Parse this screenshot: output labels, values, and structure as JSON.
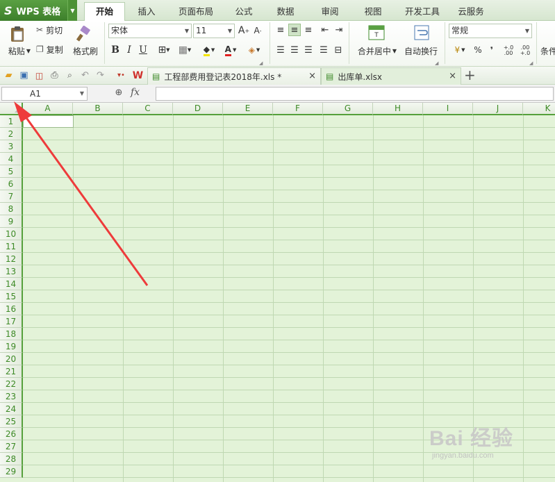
{
  "app": {
    "name": "WPS 表格",
    "logo_letter": "S"
  },
  "menu_tabs": [
    {
      "label": "开始",
      "active": true
    },
    {
      "label": "插入",
      "active": false
    },
    {
      "label": "页面布局",
      "active": false
    },
    {
      "label": "公式",
      "active": false
    },
    {
      "label": "数据",
      "active": false
    },
    {
      "label": "审阅",
      "active": false
    },
    {
      "label": "视图",
      "active": false
    },
    {
      "label": "开发工具",
      "active": false
    },
    {
      "label": "云服务",
      "active": false
    }
  ],
  "ribbon": {
    "paste": "粘贴",
    "cut": "剪切",
    "copy": "复制",
    "format_painter": "格式刷",
    "font_name": "宋体",
    "font_size": "11",
    "bold": "B",
    "italic": "I",
    "underline": "U",
    "merge_center": "合并居中",
    "wrap_text": "自动换行",
    "number_format": "常规",
    "percent": "%",
    "comma": "❜",
    "conditional": "条件"
  },
  "documents": [
    {
      "title": "工程部费用登记表2018年.xls *",
      "active": false
    },
    {
      "title": "出库单.xlsx",
      "active": true
    }
  ],
  "formula_bar": {
    "name_box": "A1",
    "fx_label": "fx",
    "formula": ""
  },
  "sheet": {
    "columns": [
      "A",
      "B",
      "C",
      "D",
      "E",
      "F",
      "G",
      "H",
      "I",
      "J",
      "K"
    ],
    "rows": [
      "1",
      "2",
      "3",
      "4",
      "5",
      "6",
      "7",
      "8",
      "9",
      "10",
      "11",
      "12",
      "13",
      "14",
      "15",
      "16",
      "17",
      "18",
      "19",
      "20",
      "21",
      "22",
      "23",
      "24",
      "25",
      "26",
      "27",
      "28",
      "29"
    ],
    "selected_cell": "A1",
    "grid_color": "#e3f3d8",
    "header_accent": "#55a03b"
  },
  "annotation": {
    "arrow_color": "#ee3b3b",
    "points_to": "select-all-corner"
  },
  "watermark": {
    "brand": "Bai 经验",
    "url": "jingyan.baidu.com"
  }
}
